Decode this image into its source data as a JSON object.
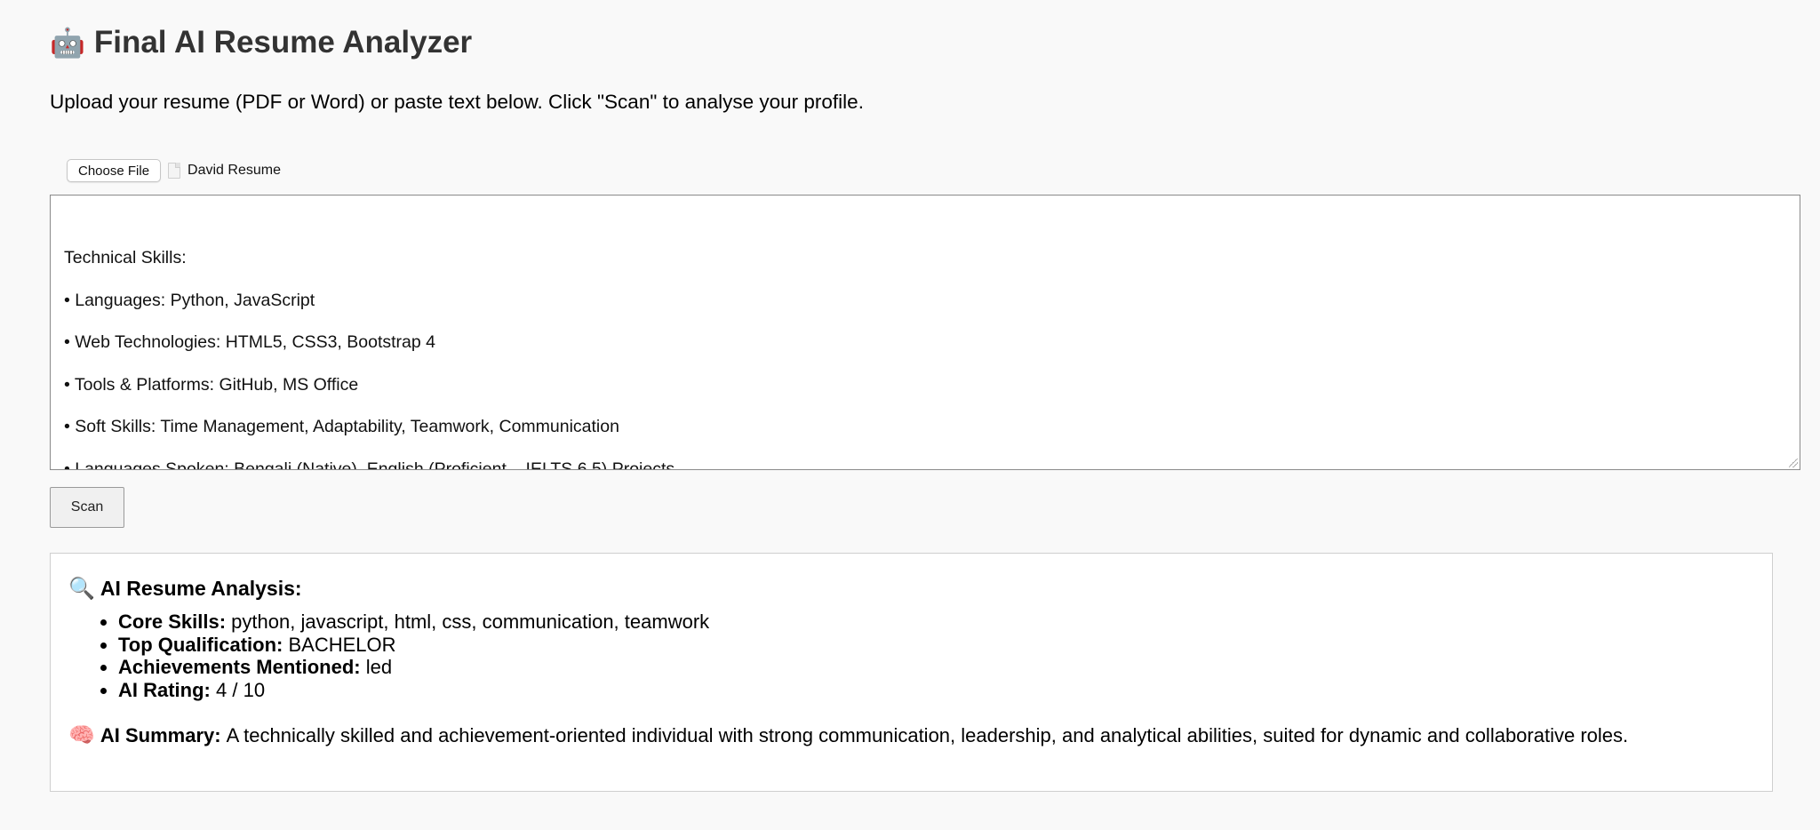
{
  "header": {
    "icon": "robot-icon",
    "title": "Final AI Resume Analyzer",
    "subtitle": "Upload your resume (PDF or Word) or paste text below. Click \"Scan\" to analyse your profile."
  },
  "upload": {
    "choose_label": "Choose File",
    "file_icon": "document-icon",
    "file_name": "David Resume"
  },
  "resume_text": {
    "lines": [
      "Technical Skills:",
      "• Languages: Python, JavaScript",
      "• Web Technologies: HTML5, CSS3, Bootstrap 4",
      "• Tools & Platforms: GitHub, MS Office",
      "• Soft Skills: Time Management, Adaptability, Teamwork, Communication",
      "• Languages Spoken: Bengali (Native), English (Proficient – IELTS 6.5) Projects"
    ]
  },
  "scan": {
    "label": "Scan"
  },
  "analysis": {
    "heading_icon": "magnifier-icon",
    "heading": "AI Resume Analysis:",
    "items": [
      {
        "label": "Core Skills:",
        "value": "python, javascript, html, css, communication, teamwork"
      },
      {
        "label": "Top Qualification:",
        "value": "BACHELOR"
      },
      {
        "label": "Achievements Mentioned:",
        "value": "led"
      },
      {
        "label": "AI Rating:",
        "value": "4 / 10"
      }
    ],
    "summary_icon": "brain-icon",
    "summary_label": "AI Summary:",
    "summary_text": "A technically skilled and achievement-oriented individual with strong communication, leadership, and analytical abilities, suited for dynamic and collaborative roles."
  }
}
